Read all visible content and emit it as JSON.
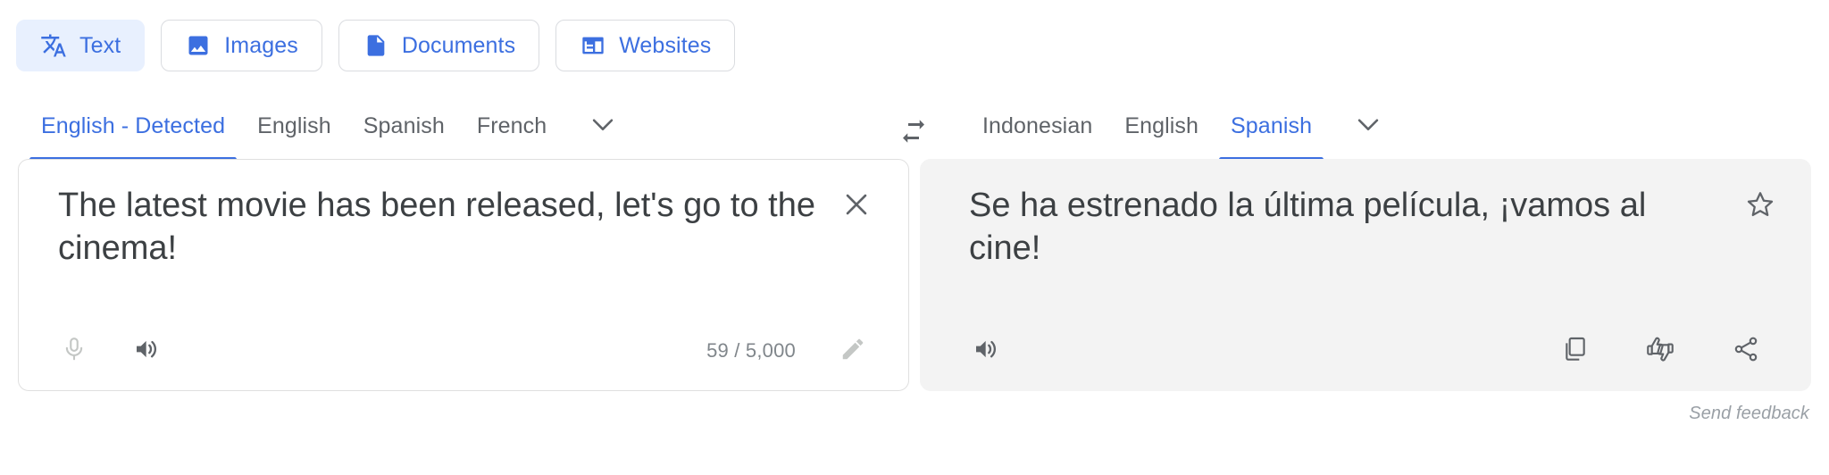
{
  "mode_tabs": [
    {
      "label": "Text",
      "icon": "translate-icon",
      "selected": true
    },
    {
      "label": "Images",
      "icon": "image-icon",
      "selected": false
    },
    {
      "label": "Documents",
      "icon": "document-icon",
      "selected": false
    },
    {
      "label": "Websites",
      "icon": "website-icon",
      "selected": false
    }
  ],
  "source": {
    "languages": [
      {
        "label": "English - Detected",
        "active": true
      },
      {
        "label": "English",
        "active": false
      },
      {
        "label": "Spanish",
        "active": false
      },
      {
        "label": "French",
        "active": false
      }
    ],
    "more_languages_icon": "chevron-down-icon",
    "text": "The latest movie has been released, let's go to the cinema!",
    "clear_icon": "close-icon",
    "mic_icon": "microphone-icon",
    "listen_icon": "speaker-icon",
    "char_count": "59 / 5,000",
    "edit_icon": "pencil-icon"
  },
  "swap_icon": "swap-languages-icon",
  "target": {
    "languages": [
      {
        "label": "Indonesian",
        "active": false
      },
      {
        "label": "English",
        "active": false
      },
      {
        "label": "Spanish",
        "active": true
      }
    ],
    "more_languages_icon": "chevron-down-icon",
    "text": "Se ha estrenado la última película, ¡vamos al cine!",
    "save_icon": "star-icon",
    "listen_icon": "speaker-icon",
    "copy_icon": "copy-icon",
    "rate_icon": "thumbs-up-down-icon",
    "share_icon": "share-icon"
  },
  "footer": {
    "send_feedback": "Send feedback"
  },
  "colors": {
    "accent": "#3c6fe0",
    "selected_chip_bg": "#e8f0fe",
    "target_panel_bg": "#f3f3f3",
    "text": "#3c4043",
    "muted": "#5f6368"
  }
}
